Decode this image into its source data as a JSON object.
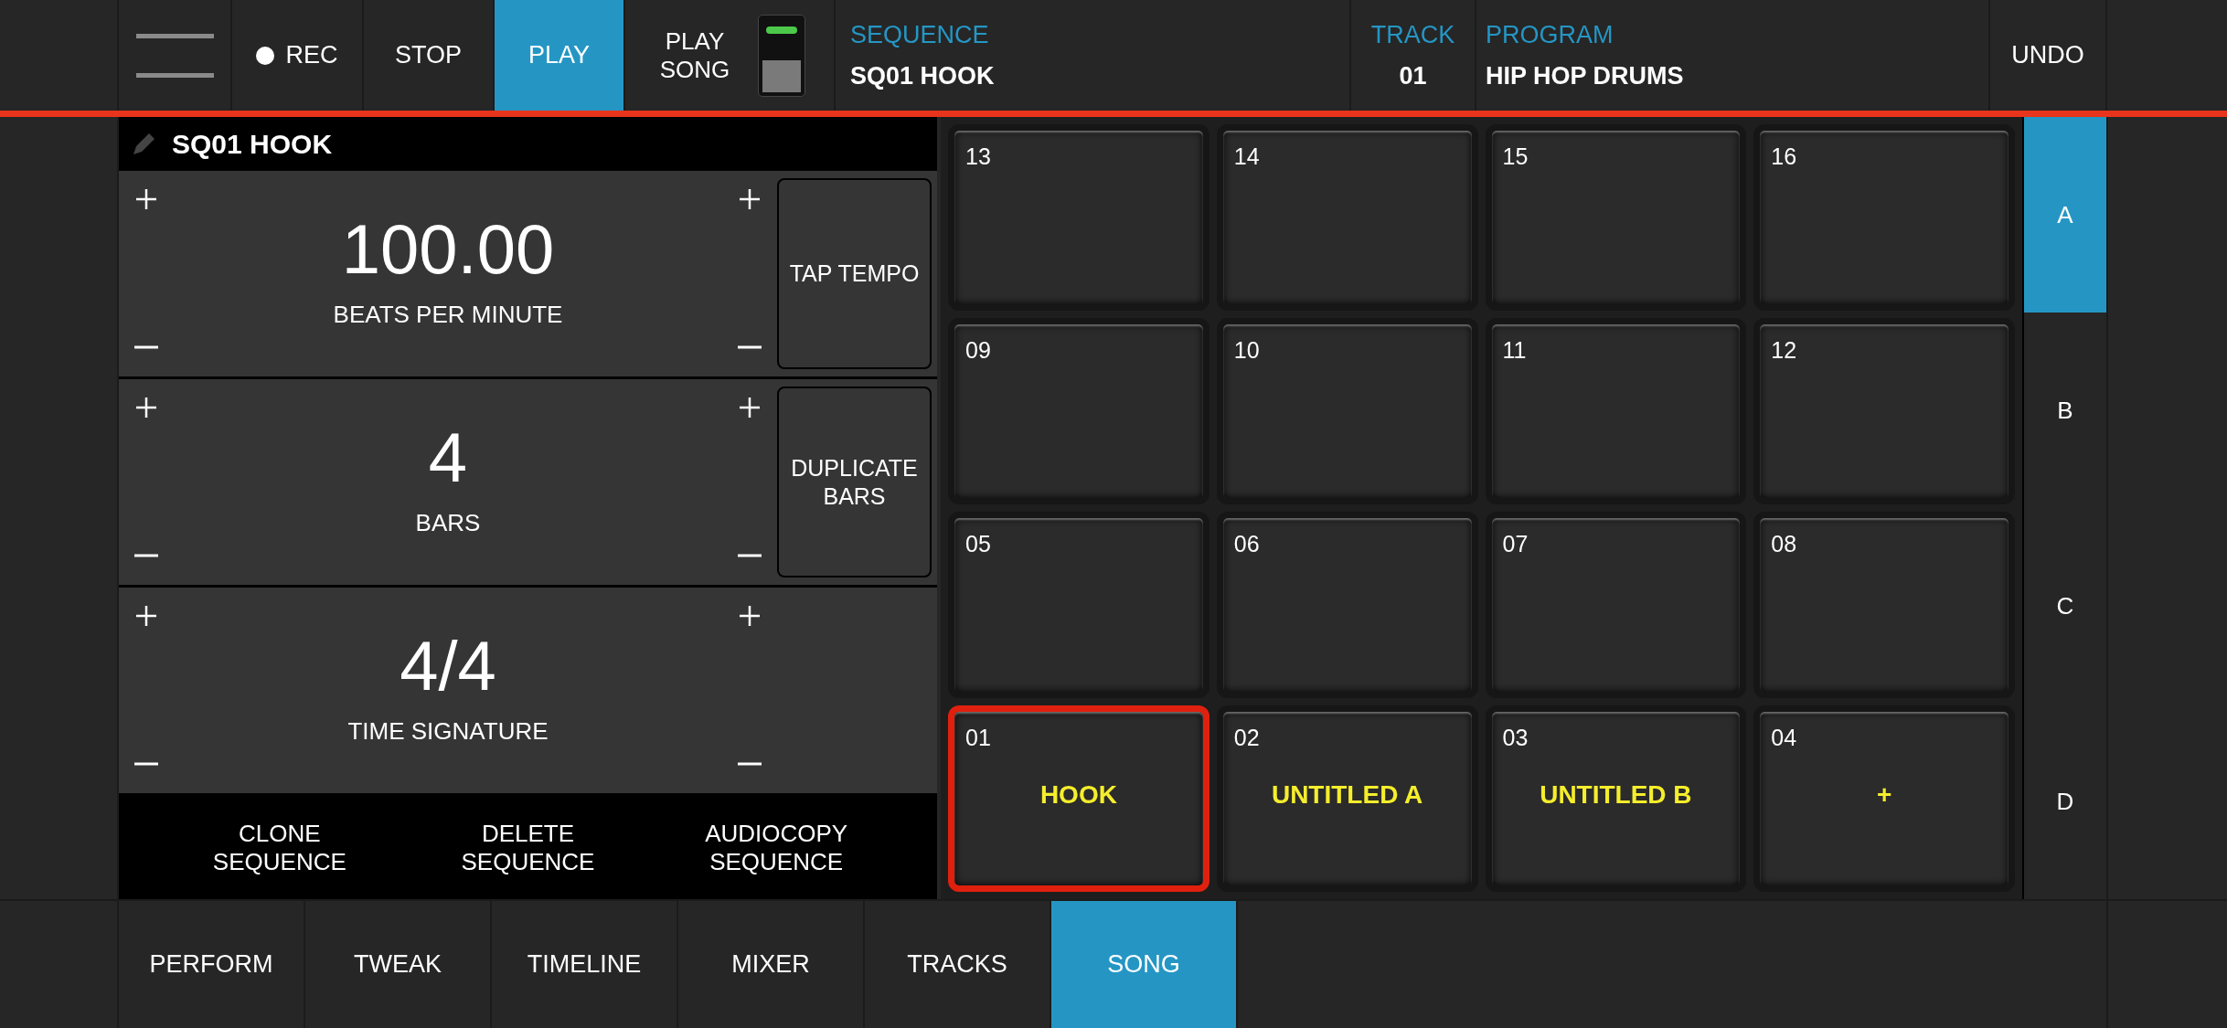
{
  "top_bar": {
    "transport": [
      {
        "kind": "rec",
        "label": "REC",
        "selected": false
      },
      {
        "kind": "plain",
        "label": "STOP",
        "selected": false
      },
      {
        "kind": "plain",
        "label": "PLAY",
        "selected": true
      }
    ],
    "play_song": {
      "label": "PLAY SONG",
      "on": true
    },
    "sequence": {
      "label": "SEQUENCE",
      "value": "SQ01 HOOK"
    },
    "track": {
      "label": "TRACK",
      "value": "01"
    },
    "program": {
      "label": "PROGRAM",
      "value": "HIP HOP DRUMS"
    },
    "undo": "UNDO"
  },
  "sequence_panel": {
    "title": "SQ01 HOOK",
    "params": [
      {
        "value": "100.00",
        "label": "BEATS PER MINUTE",
        "button": "TAP TEMPO"
      },
      {
        "value": "4",
        "label": "BARS",
        "button": "DUPLICATE BARS"
      },
      {
        "value": "4/4",
        "label": "TIME SIGNATURE"
      }
    ],
    "actions": [
      "CLONE SEQUENCE",
      "DELETE SEQUENCE",
      "AUDIOCOPY SEQUENCE"
    ]
  },
  "pads": [
    [
      {
        "number": "13",
        "selected": false
      },
      {
        "number": "14",
        "selected": false
      },
      {
        "number": "15",
        "selected": false
      },
      {
        "number": "16",
        "selected": false
      }
    ],
    [
      {
        "number": "09",
        "selected": false
      },
      {
        "number": "10",
        "selected": false
      },
      {
        "number": "11",
        "selected": false
      },
      {
        "number": "12",
        "selected": false
      }
    ],
    [
      {
        "number": "05",
        "selected": false
      },
      {
        "number": "06",
        "selected": false
      },
      {
        "number": "07",
        "selected": false
      },
      {
        "number": "08",
        "selected": false
      }
    ],
    [
      {
        "number": "01",
        "name": "HOOK",
        "selected": true
      },
      {
        "number": "02",
        "name": "UNTITLED A",
        "selected": false
      },
      {
        "number": "03",
        "name": "UNTITLED B",
        "selected": false
      },
      {
        "number": "04",
        "name": "+",
        "selected": false
      }
    ]
  ],
  "banks": [
    {
      "label": "A",
      "selected": true
    },
    {
      "label": "B",
      "selected": false
    },
    {
      "label": "C",
      "selected": false
    },
    {
      "label": "D",
      "selected": false
    }
  ],
  "tabs": [
    {
      "label": "PERFORM",
      "selected": false
    },
    {
      "label": "TWEAK",
      "selected": false
    },
    {
      "label": "TIMELINE",
      "selected": false
    },
    {
      "label": "MIXER",
      "selected": false
    },
    {
      "label": "TRACKS",
      "selected": false
    },
    {
      "label": "SONG",
      "selected": true
    }
  ]
}
